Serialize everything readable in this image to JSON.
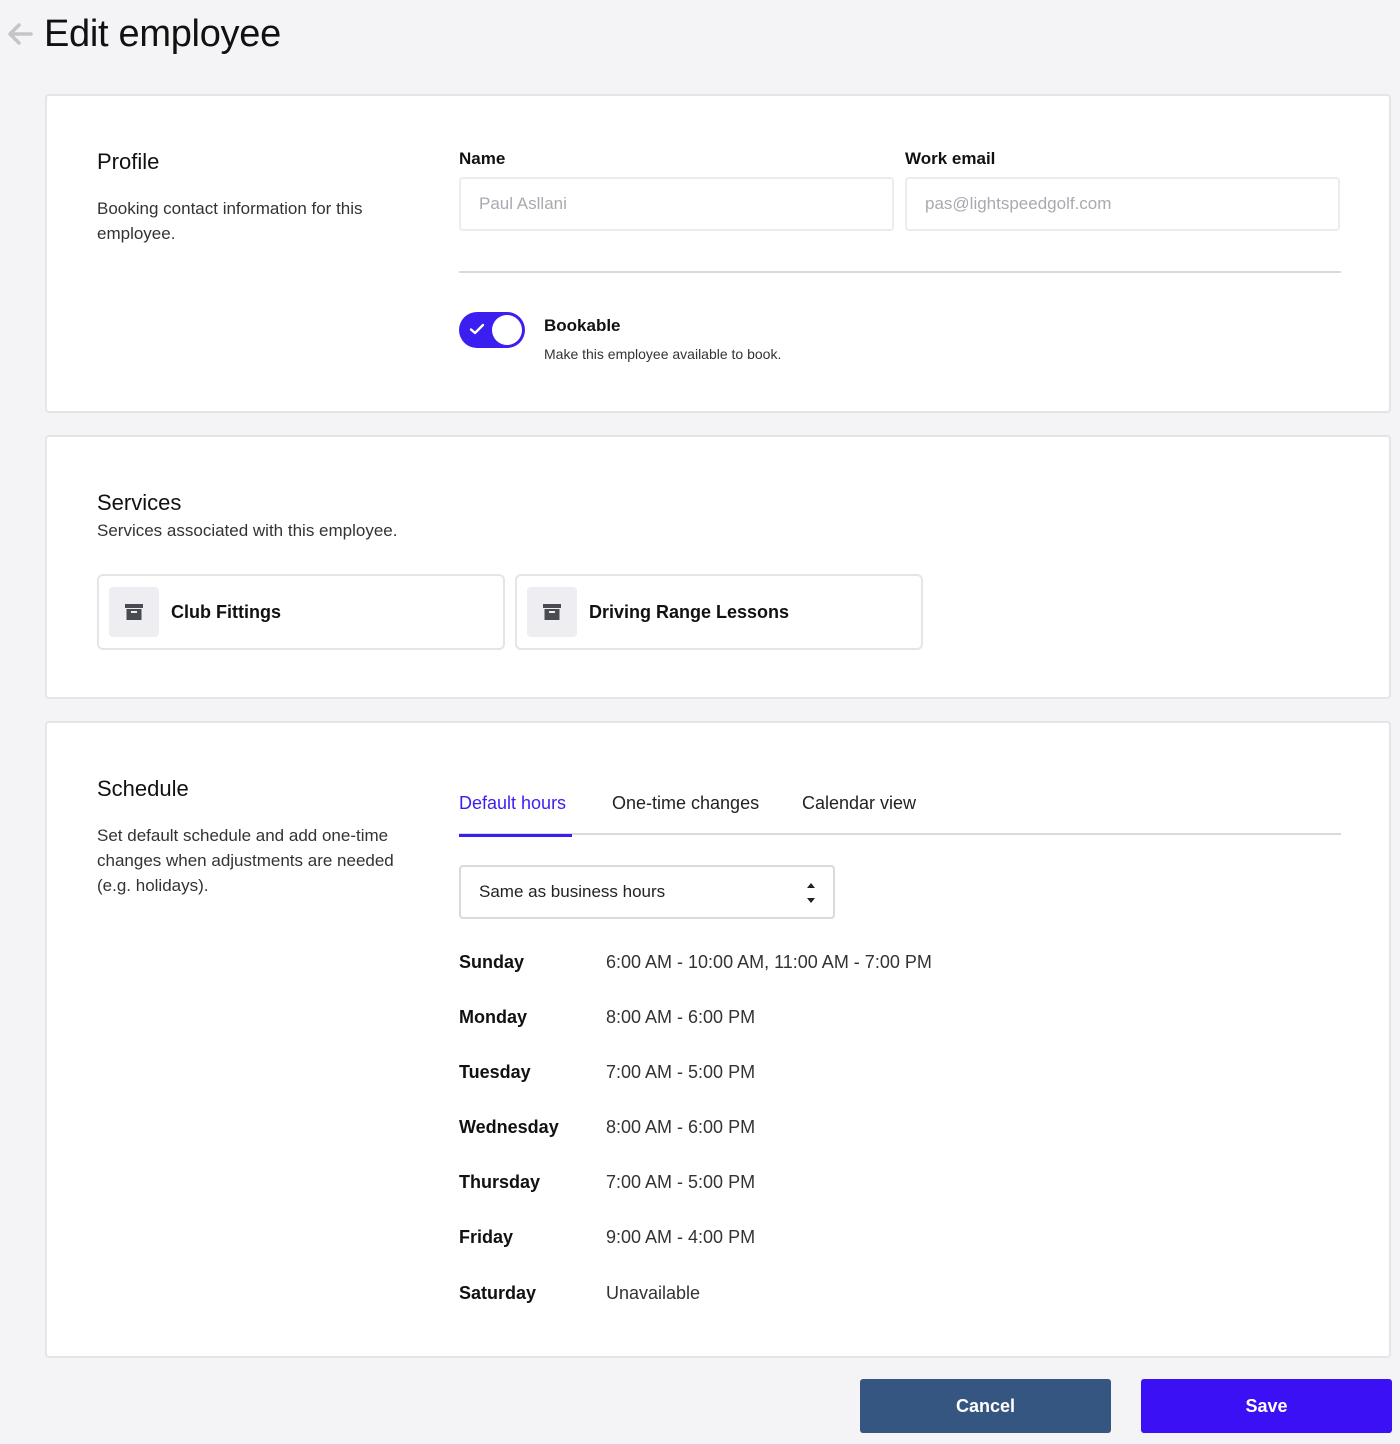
{
  "header": {
    "title": "Edit employee",
    "back_icon": "arrow-left-icon"
  },
  "profile": {
    "title": "Profile",
    "description": "Booking contact information for this employee.",
    "name_label": "Name",
    "name_placeholder": "Paul Asllani",
    "email_label": "Work email",
    "email_placeholder": "pas@lightspeedgolf.com",
    "bookable": {
      "title": "Bookable",
      "description": "Make this employee available to book.",
      "enabled": true
    }
  },
  "services": {
    "title": "Services",
    "description": "Services associated with this employee.",
    "items": [
      {
        "label": "Club Fittings",
        "icon": "archive-box-icon"
      },
      {
        "label": "Driving Range Lessons",
        "icon": "archive-box-icon"
      }
    ]
  },
  "schedule": {
    "title": "Schedule",
    "description": "Set default schedule and add one-time changes when adjustments are needed (e.g. holidays).",
    "tabs": [
      {
        "label": "Default hours",
        "active": true
      },
      {
        "label": "One-time changes",
        "active": false
      },
      {
        "label": "Calendar view",
        "active": false
      }
    ],
    "select_value": "Same as business hours",
    "hours": [
      {
        "day": "Sunday",
        "time": "6:00 AM - 10:00 AM, 11:00 AM - 7:00 PM"
      },
      {
        "day": "Monday",
        "time": "8:00 AM - 6:00 PM"
      },
      {
        "day": "Tuesday",
        "time": "7:00 AM - 5:00 PM"
      },
      {
        "day": "Wednesday",
        "time": "8:00 AM - 6:00 PM"
      },
      {
        "day": "Thursday",
        "time": "7:00 AM - 5:00 PM"
      },
      {
        "day": "Friday",
        "time": "9:00 AM - 4:00 PM"
      },
      {
        "day": "Saturday",
        "time": "Unavailable"
      }
    ]
  },
  "actions": {
    "cancel_label": "Cancel",
    "save_label": "Save"
  },
  "colors": {
    "accent": "#3b1ef0",
    "cancel": "#345681",
    "save": "#3b10f5",
    "background": "#f4f3f6"
  }
}
